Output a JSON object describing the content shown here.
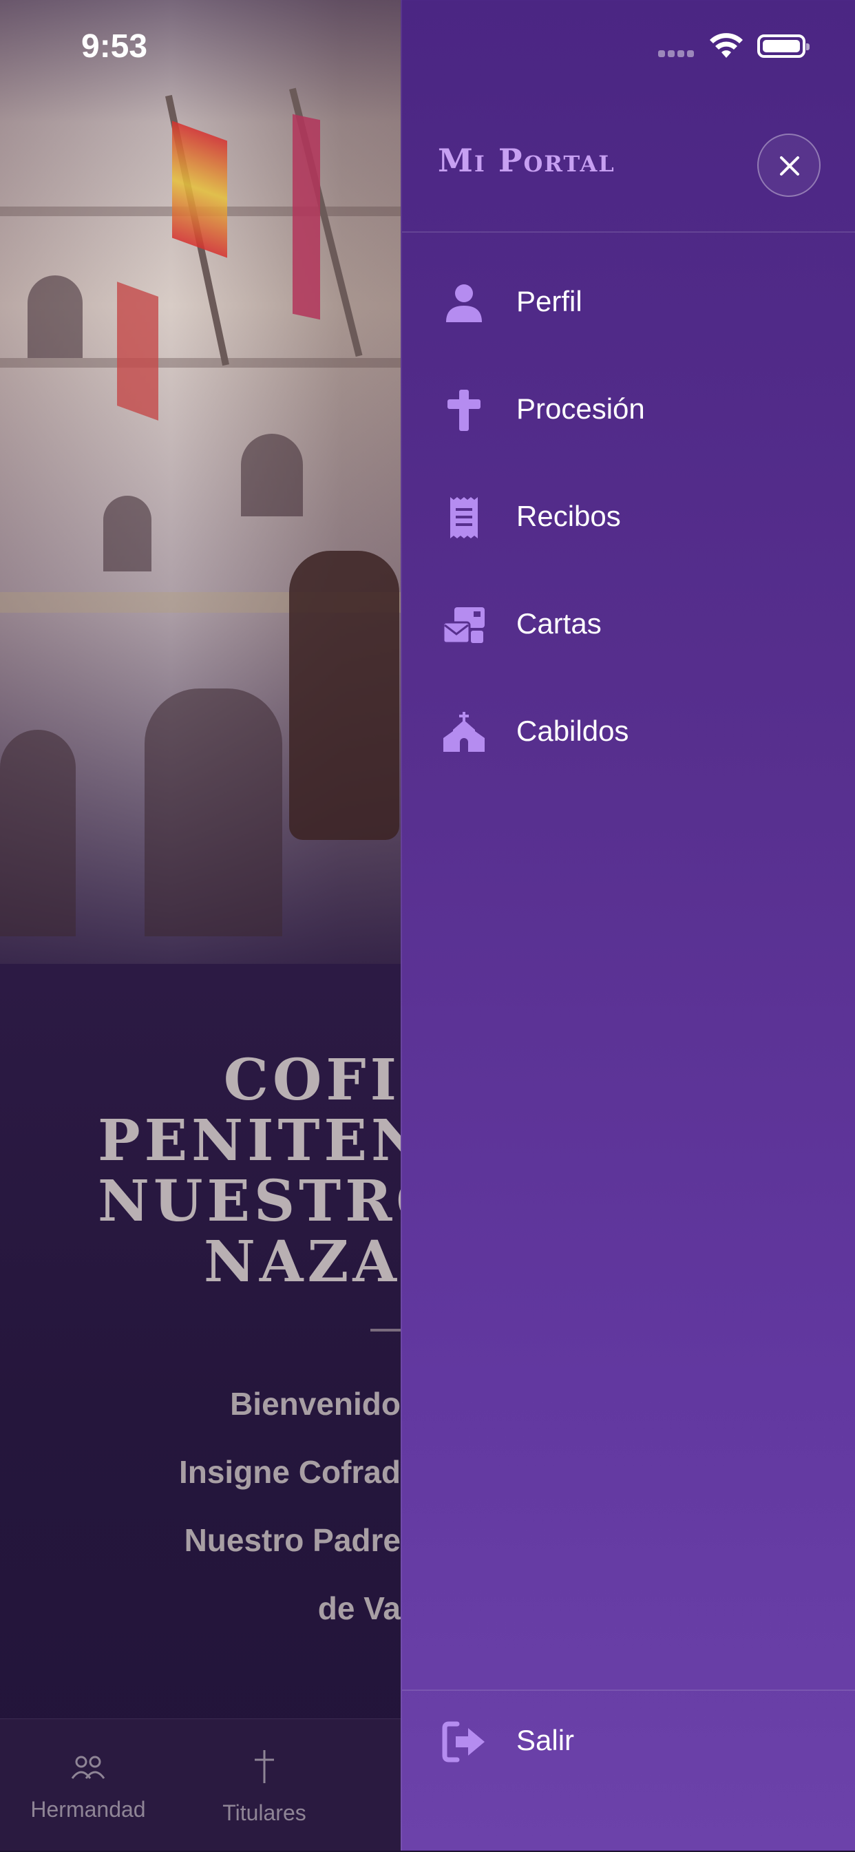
{
  "status_bar": {
    "time": "9:53"
  },
  "drawer": {
    "title": "Mi Portal",
    "close_icon": "close-icon",
    "items": [
      {
        "label": "Perfil",
        "icon": "user-icon"
      },
      {
        "label": "Procesión",
        "icon": "cross-icon"
      },
      {
        "label": "Recibos",
        "icon": "receipt-icon"
      },
      {
        "label": "Cartas",
        "icon": "mail-icon"
      },
      {
        "label": "Cabildos",
        "icon": "church-icon"
      }
    ],
    "logout": {
      "label": "Salir",
      "icon": "logout-icon"
    }
  },
  "background": {
    "title_lines": [
      "COFI",
      "PENITEN",
      "NUESTRO P",
      "NAZA"
    ],
    "welcome_lines": [
      "Bienvenido",
      "Insigne Cofrad",
      "Nuestro Padre",
      "de Va"
    ],
    "tabs": [
      {
        "label": "Hermandad",
        "icon": "people-icon"
      },
      {
        "label": "Titulares",
        "icon": "cross-icon"
      }
    ]
  },
  "colors": {
    "drawer_bg": "#572f8e",
    "accent": "#c7a0f2",
    "icon": "#b58cf0"
  }
}
